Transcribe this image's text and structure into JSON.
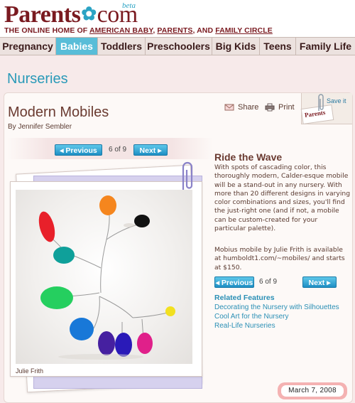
{
  "header": {
    "logo_left": "Parents",
    "logo_right": "com",
    "beta": "beta",
    "tagline_prefix": "THE ONLINE HOME OF ",
    "tagline_link1": "AMERICAN BABY",
    "tagline_sep1": ", ",
    "tagline_link2": "PARENTS",
    "tagline_sep2": ", AND ",
    "tagline_link3": "FAMILY CIRCLE"
  },
  "nav": {
    "items": [
      {
        "label": "Pregnancy"
      },
      {
        "label": "Babies"
      },
      {
        "label": "Toddlers"
      },
      {
        "label": "Preschoolers"
      },
      {
        "label": "Big Kids"
      },
      {
        "label": "Teens"
      },
      {
        "label": "Family Life"
      }
    ],
    "active": "Babies"
  },
  "section": {
    "title": "Nurseries"
  },
  "article": {
    "title": "Modern Mobiles",
    "byline": "By Jennifer Sembler",
    "share_label": "Share",
    "print_label": "Print",
    "save_label": "Save it",
    "save_paper": "Parents"
  },
  "pager": {
    "prev_label": "◂ Previous",
    "next_label": "Next ▸",
    "count": "6 of 9"
  },
  "slide": {
    "title": "Ride the Wave",
    "description": "With spots of cascading color, this thoroughly modern, Calder-esque mobile will be a stand-out in any nursery. With more than 20 different designs in varying color combinations and sizes, you'll find the just-right one (and if not, a mobile can be custom-created for your particular palette).",
    "availability": "Mobius mobile by Julie Frith is available at humboldt1.com/~mobiles/ and starts at $150.",
    "photo_credit": "Julie Frith"
  },
  "related": {
    "heading": "Related Features",
    "links": [
      "Decorating the Nursery with Silhouettes",
      "Cool Art for the Nursery",
      "Real-Life Nurseries"
    ]
  },
  "date": "March 7, 2008",
  "colors": {
    "brand": "#7a1a20",
    "accent": "#2ba3c4",
    "nav_active": "#58bdd8",
    "link": "#2a8fb5"
  },
  "icons": [
    "flower-icon",
    "envelope-icon",
    "printer-icon",
    "paperclip-icon"
  ]
}
